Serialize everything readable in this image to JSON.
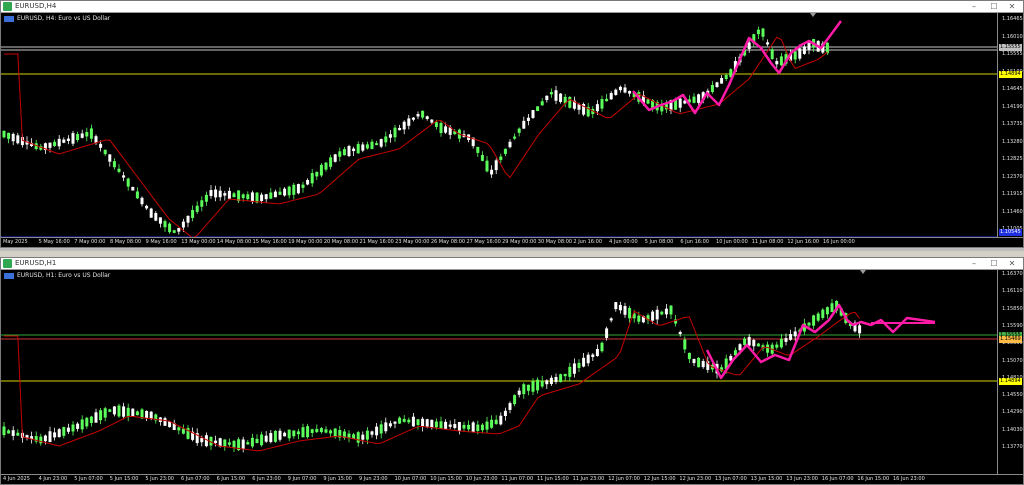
{
  "windows": [
    {
      "id": "h4",
      "title": "EURUSD,H4",
      "symbol_label": "EURUSD, H4: Euro vs US Dollar",
      "price_labels": [
        "1.16465",
        "1.16010",
        "1.15555",
        "1.15100",
        "1.14645",
        "1.14190",
        "1.13735",
        "1.13280",
        "1.12825",
        "1.12370",
        "1.11915",
        "1.11460",
        "1.11005"
      ],
      "price_boxes": [
        {
          "text": "1.15555",
          "bg": "#c0c0c0"
        },
        {
          "text": "1.14894",
          "bg": "#ffff00"
        },
        {
          "text": "1.10545",
          "bg": "#1e2fe0"
        }
      ],
      "time_labels": [
        "May 2025",
        "5 May 16:00",
        "7 May 00:00",
        "8 May 08:00",
        "9 May 16:00",
        "13 May 00:00",
        "14 May 08:00",
        "15 May 16:00",
        "19 May 00:00",
        "20 May 08:00",
        "21 May 16:00",
        "23 May 00:00",
        "26 May 08:00",
        "27 May 16:00",
        "29 May 00:00",
        "30 May 08:00",
        "2 Jun 16:00",
        "4 Jun 00:00",
        "5 Jun 08:00",
        "6 Jun 16:00",
        "10 Jun 00:00",
        "11 Jun 08:00",
        "12 Jun 16:00",
        "16 Jun 00:00"
      ]
    },
    {
      "id": "h1",
      "title": "EURUSD,H1",
      "symbol_label": "EURUSD, H1: Euro vs US Dollar",
      "price_labels": [
        "1.16370",
        "1.16110",
        "1.15850",
        "1.15590",
        "1.15330",
        "1.15070",
        "1.14810",
        "1.14550",
        "1.14290",
        "1.14030",
        "1.13770"
      ],
      "price_boxes": [
        {
          "text": "1.15555",
          "bg": "#44aa44"
        },
        {
          "text": "1.15469",
          "bg": "#ffbb44"
        },
        {
          "text": "1.14894",
          "bg": "#ffff00"
        }
      ],
      "time_labels": [
        "4 Jun 2025",
        "4 Jun 23:00",
        "5 Jun 07:00",
        "5 Jun 15:00",
        "5 Jun 23:00",
        "6 Jun 07:00",
        "6 Jun 15:00",
        "6 Jun 23:00",
        "9 Jun 07:00",
        "9 Jun 15:00",
        "9 Jun 23:00",
        "10 Jun 07:00",
        "10 Jun 15:00",
        "10 Jun 23:00",
        "11 Jun 07:00",
        "11 Jun 15:00",
        "11 Jun 23:00",
        "12 Jun 07:00",
        "12 Jun 15:00",
        "12 Jun 23:00",
        "13 Jun 07:00",
        "13 Jun 15:00",
        "13 Jun 23:00",
        "16 Jun 07:00",
        "16 Jun 15:00",
        "16 Jun 23:00"
      ]
    }
  ],
  "colors": {
    "bull": "#5dff5d",
    "bear": "#ffffff",
    "ma": "#c80000",
    "forecast": "#ff1aa8",
    "level_gray": "#c8c8c8",
    "level_yellow": "#d4d400",
    "level_green": "#2ea82e",
    "level_red": "#cc3333",
    "level_blue": "#1e2fe0"
  },
  "icons": [
    "app-icon",
    "minimize-icon",
    "maximize-icon",
    "close-icon",
    "symbol-flag-icon"
  ]
}
